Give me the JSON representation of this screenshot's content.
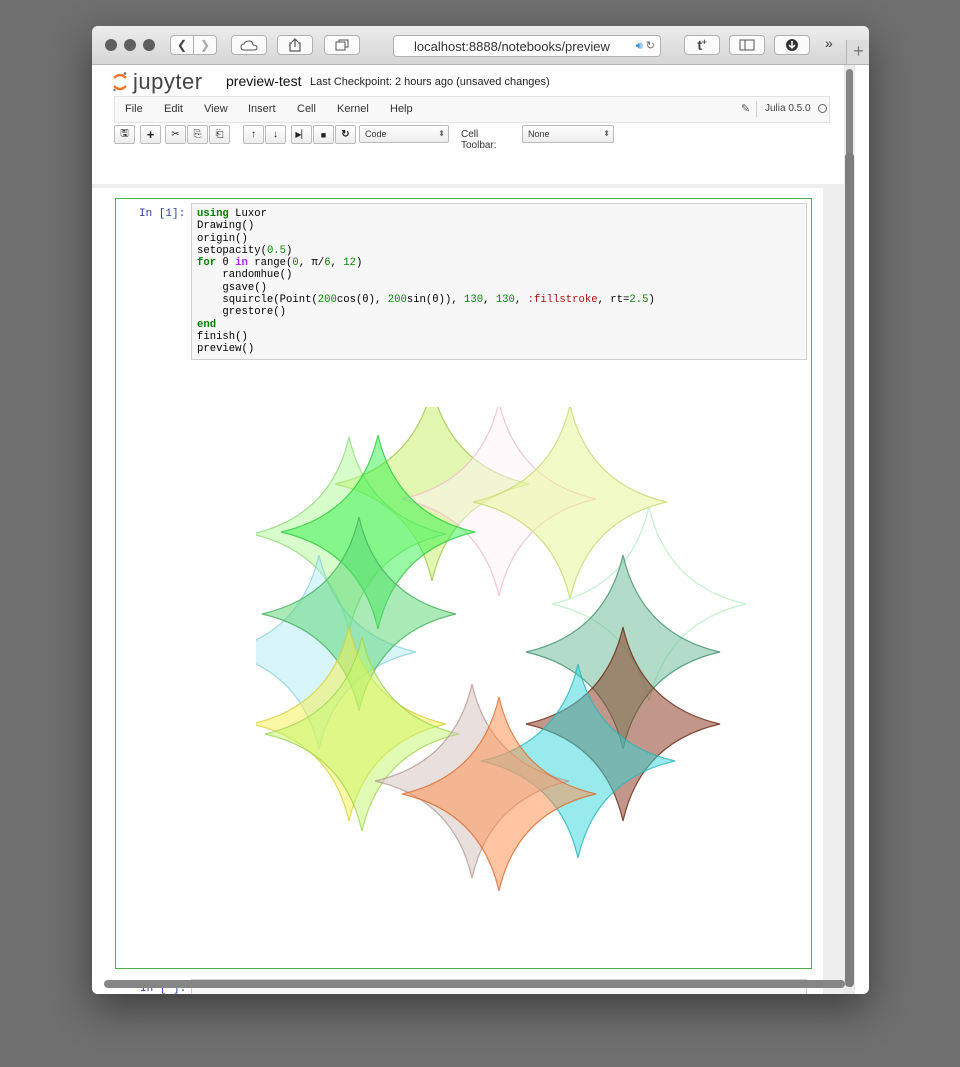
{
  "browser": {
    "url": "localhost:8888/notebooks/preview",
    "overflow": "»",
    "new_tab": "+"
  },
  "notebook": {
    "logo": "jupyter",
    "name": "preview-test",
    "checkpoint": "Last Checkpoint: 2 hours ago (unsaved changes)",
    "kernel": "Julia 0.5.0"
  },
  "menu": [
    "File",
    "Edit",
    "View",
    "Insert",
    "Cell",
    "Kernel",
    "Help"
  ],
  "toolbar": {
    "cell_type": "Code",
    "cell_toolbar_label": "Cell Toolbar:",
    "cell_toolbar_value": "None"
  },
  "cells": {
    "cell1_prompt": "In [1]:",
    "cell2_prompt": "In [ ]:"
  },
  "colors": {
    "selected_border": "#4caf50",
    "prompt": "#303f9f",
    "keyword": "#008000"
  },
  "output_shapes": [
    {
      "color": "#c6ef5f",
      "stroke": "#9ec64a"
    },
    {
      "color": "#fff4f7",
      "stroke": "#f3b8cf"
    },
    {
      "color": "#e6f590",
      "stroke": "#c6d870"
    },
    {
      "color": "#adfb96",
      "stroke": "#8ed87b"
    },
    {
      "color": "#33f24a",
      "stroke": "#2acb3e"
    },
    {
      "color": "#ffffff",
      "stroke": "#b5ecc4"
    },
    {
      "color": "#b2ecf4",
      "stroke": "#8fcfdb"
    },
    {
      "color": "#56d56f",
      "stroke": "#45b05b"
    },
    {
      "color": "#65b993",
      "stroke": "#3f8e6a"
    },
    {
      "color": "#f6f04c",
      "stroke": "#d6d03c"
    },
    {
      "color": "#c3f86a",
      "stroke": "#a0d552"
    },
    {
      "color": "#843017",
      "stroke": "#6a2510"
    },
    {
      "color": "#32d5d9",
      "stroke": "#27b4b8"
    },
    {
      "color": "#d3bfb9",
      "stroke": "#b09a95"
    },
    {
      "color": "#ff8b47",
      "stroke": "#d96c2f"
    }
  ]
}
